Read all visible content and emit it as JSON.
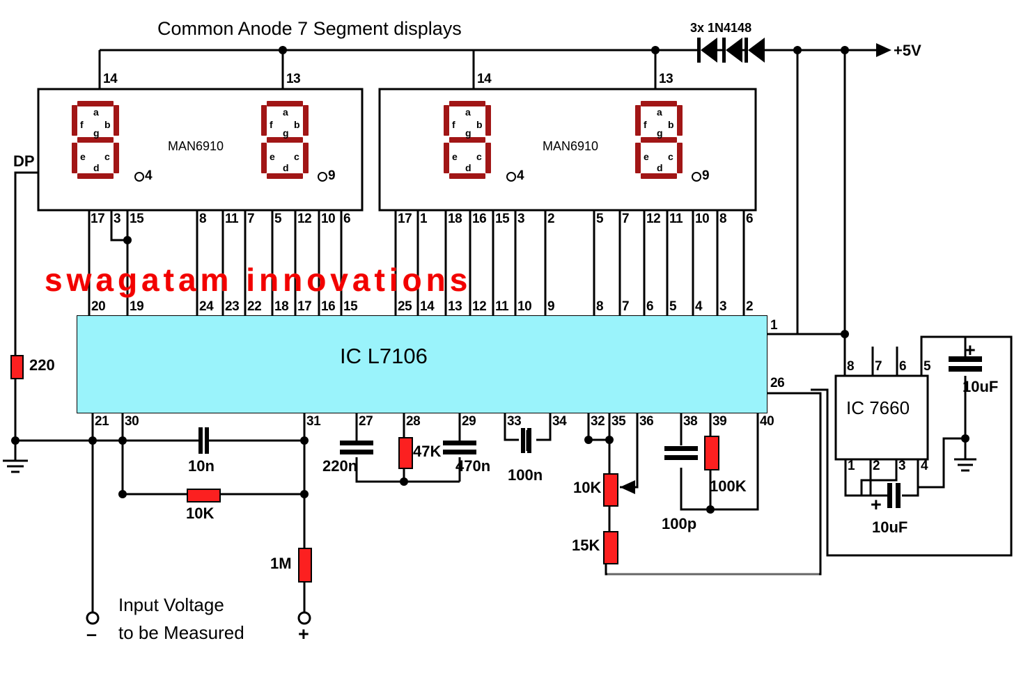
{
  "diagram": {
    "title": "Common Anode 7 Segment displays",
    "watermark": "swagatam innovations",
    "diode_label": "3x 1N4148",
    "rail_label": "+5V",
    "dp_label": "DP",
    "input_line1": "Input Voltage",
    "input_line2": "to be Measured",
    "terminal_minus": "–",
    "terminal_plus": "+",
    "colors": {
      "ic_fill": "#9af3fb",
      "resistor": "#fc2020",
      "segment": "#a11616",
      "watermark": "#f20000",
      "wire": "#000000"
    }
  },
  "displays": [
    {
      "part": "MAN6910",
      "top_pins": [
        "14",
        "13"
      ],
      "digit_dp_pins": [
        "4",
        "9"
      ],
      "segment_letters": [
        "a",
        "b",
        "c",
        "d",
        "e",
        "f",
        "g"
      ],
      "bottom_pins": [
        "17",
        "3",
        "15",
        "8",
        "11",
        "7",
        "5",
        "12",
        "10",
        "6"
      ]
    },
    {
      "part": "MAN6910",
      "top_pins": [
        "14",
        "13"
      ],
      "digit_dp_pins": [
        "4",
        "9"
      ],
      "segment_letters": [
        "a",
        "b",
        "c",
        "d",
        "e",
        "f",
        "g"
      ],
      "bottom_pins": [
        "17",
        "1",
        "18",
        "16",
        "15",
        "3",
        "2",
        "5",
        "7",
        "12",
        "11",
        "10",
        "8",
        "6"
      ]
    }
  ],
  "main_ic": {
    "label": "IC L7106",
    "top_pins": [
      "20",
      "19",
      "24",
      "23",
      "22",
      "18",
      "17",
      "16",
      "15",
      "25",
      "14",
      "13",
      "12",
      "11",
      "10",
      "9",
      "8",
      "7",
      "6",
      "5",
      "4",
      "3",
      "2"
    ],
    "bottom_pins": [
      "21",
      "30",
      "31",
      "27",
      "28",
      "29",
      "33",
      "34",
      "32",
      "35",
      "36",
      "38",
      "39",
      "40"
    ],
    "right_pins": [
      "1",
      "26"
    ]
  },
  "charge_pump_ic": {
    "label": "IC 7660",
    "top_pins": [
      "8",
      "7",
      "6",
      "5"
    ],
    "bottom_pins": [
      "1",
      "2",
      "3",
      "4"
    ]
  },
  "components": [
    {
      "name": "r-220",
      "value": "220",
      "type": "resistor"
    },
    {
      "name": "c-10n",
      "value": "10n",
      "type": "capacitor"
    },
    {
      "name": "r-10k-div",
      "value": "10K",
      "type": "resistor"
    },
    {
      "name": "r-1m",
      "value": "1M",
      "type": "resistor"
    },
    {
      "name": "c-220n",
      "value": "220n",
      "type": "capacitor"
    },
    {
      "name": "r-47k",
      "value": "47K",
      "type": "resistor"
    },
    {
      "name": "c-470n",
      "value": "470n",
      "type": "capacitor"
    },
    {
      "name": "c-100n",
      "value": "100n",
      "type": "capacitor"
    },
    {
      "name": "pot-10k",
      "value": "10K",
      "type": "potentiometer"
    },
    {
      "name": "r-15k",
      "value": "15K",
      "type": "resistor"
    },
    {
      "name": "c-100p",
      "value": "100p",
      "type": "capacitor"
    },
    {
      "name": "r-100k",
      "value": "100K",
      "type": "resistor"
    },
    {
      "name": "c-10uf-out",
      "value": "10uF",
      "type": "capacitor-polarized",
      "polarity": "+"
    },
    {
      "name": "c-10uf-pump",
      "value": "10uF",
      "type": "capacitor-polarized",
      "polarity": "+"
    }
  ]
}
